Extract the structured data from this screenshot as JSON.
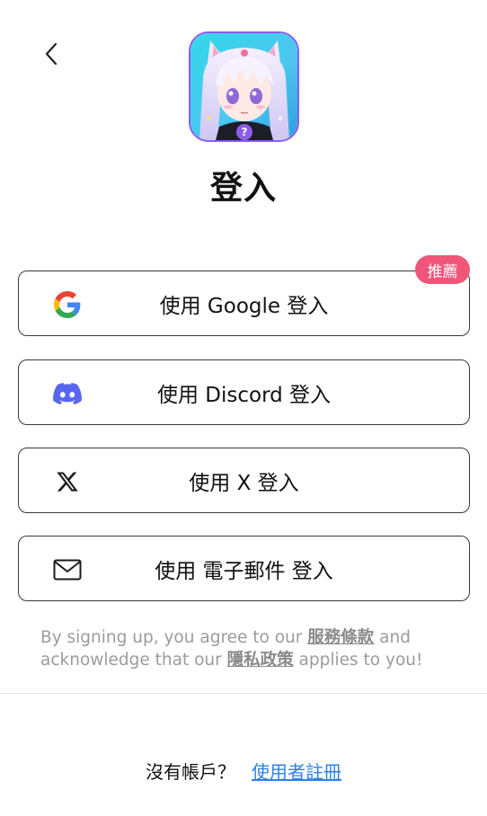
{
  "header": {
    "back_icon": "chevron-left-icon",
    "logo": "anime-cat-girl-app-icon"
  },
  "title": "登入",
  "badge": {
    "label": "推薦",
    "color": "#f0557a"
  },
  "login_options": [
    {
      "id": "google",
      "icon": "google-icon",
      "label": "使用 Google 登入"
    },
    {
      "id": "discord",
      "icon": "discord-icon",
      "label": "使用 Discord 登入"
    },
    {
      "id": "x",
      "icon": "x-icon",
      "label": "使用 X 登入"
    },
    {
      "id": "email",
      "icon": "mail-icon",
      "label": "使用 電子郵件 登入"
    }
  ],
  "terms": {
    "text1": "By signing up, you agree to our ",
    "terms_link": "服務條款",
    "text2": "  and acknowledge that our ",
    "privacy_link": "隱私政策",
    "text3": " applies to you!"
  },
  "footer": {
    "question": "沒有帳戶？",
    "register_link": "使用者註冊",
    "link_color": "#2f80ed"
  }
}
